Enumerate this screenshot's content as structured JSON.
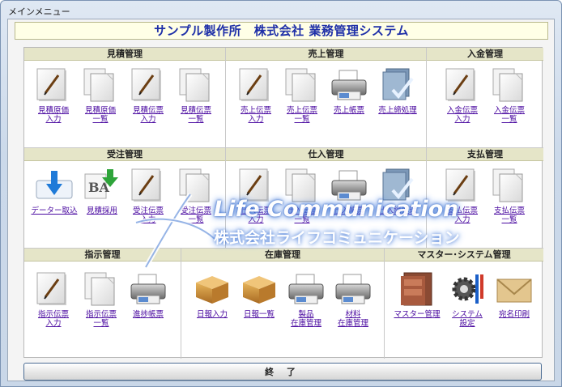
{
  "window": {
    "title": "メインメニュー"
  },
  "app_title": "サンプル製作所　株式会社 業務管理システム",
  "sections": {
    "mitsumori": {
      "title": "見積管理",
      "items": [
        "見積原価\n入力",
        "見積原価\n一覧",
        "見積伝票\n入力",
        "見積伝票\n一覧"
      ]
    },
    "uriage": {
      "title": "売上管理",
      "items": [
        "売上伝票\n入力",
        "売上伝票\n一覧",
        "売上帳票",
        "売上締処理"
      ]
    },
    "nyukin": {
      "title": "入金管理",
      "items": [
        "入金伝票\n入力",
        "入金伝票\n一覧"
      ]
    },
    "juchu": {
      "title": "受注管理",
      "items": [
        "データー取込",
        "見積採用",
        "受注伝票\n入力",
        "受注伝票\n一覧"
      ]
    },
    "shiire": {
      "title": "仕入管理",
      "items": [
        "仕入伝票\n入力",
        "仕入伝票\n一覧",
        "仕入帳票",
        "仕入締処理"
      ]
    },
    "shiharai": {
      "title": "支払管理",
      "items": [
        "支払伝票\n入力",
        "支払伝票\n一覧"
      ]
    },
    "shiji": {
      "title": "指示管理",
      "items": [
        "指示伝票\n入力",
        "指示伝票\n一覧",
        "進捗帳票"
      ]
    },
    "zaiko": {
      "title": "在庫管理",
      "items": [
        "日報入力",
        "日報一覧",
        "製品\n在庫管理",
        "材料\n在庫管理"
      ]
    },
    "master": {
      "title": "マスター･システム管理",
      "items": [
        "マスター管理",
        "システム\n設定",
        "宛名印刷"
      ]
    }
  },
  "exit_label": "終 了",
  "watermark": {
    "line1": "Life Communication",
    "line2": "株式会社ライフコミュニケーション"
  }
}
